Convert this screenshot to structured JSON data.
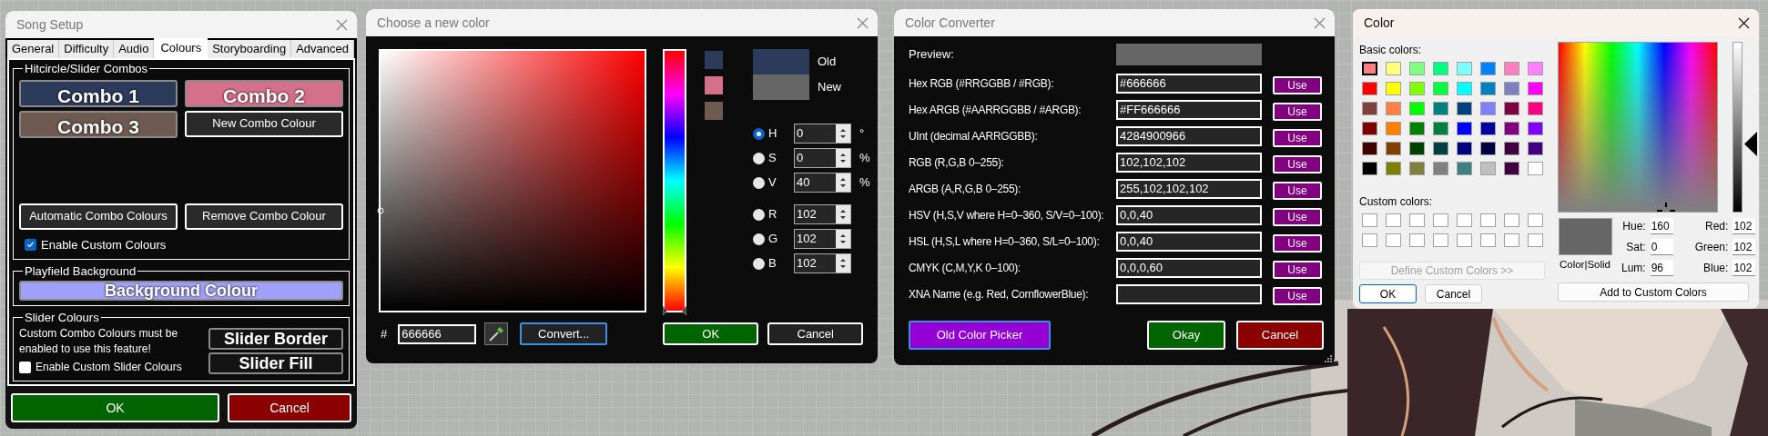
{
  "song_setup": {
    "title": "Song Setup",
    "tabs": [
      {
        "label": "General",
        "selected": false
      },
      {
        "label": "Difficulty",
        "selected": false
      },
      {
        "label": "Audio",
        "selected": false
      },
      {
        "label": "Colours",
        "selected": true
      },
      {
        "label": "Storyboarding",
        "selected": false
      },
      {
        "label": "Advanced",
        "selected": false
      }
    ],
    "combos": {
      "title": "Hitcircle/Slider Combos",
      "colours": [
        {
          "label": "Combo 1",
          "color": "#2c3a5c"
        },
        {
          "label": "Combo 2",
          "color": "#d4708a"
        },
        {
          "label": "Combo 3",
          "color": "#6e5a50"
        }
      ],
      "new_button": "New Combo Colour",
      "auto_button": "Automatic Combo Colours",
      "remove_button": "Remove Combo Colour",
      "enable": {
        "label": "Enable Custom Colours",
        "checked": true
      }
    },
    "playfield": {
      "title": "Playfield Background",
      "button": "Background Colour"
    },
    "slider": {
      "title": "Slider Colours",
      "note": "Custom Combo Colours must be enabled to use this feature!",
      "enable": {
        "label": "Enable Custom Slider Colours",
        "checked": false
      },
      "buttons": [
        "Slider Border",
        "Slider Fill"
      ]
    },
    "ok": "OK",
    "cancel": "Cancel"
  },
  "color_chooser": {
    "title": "Choose a new color",
    "recent": [
      {
        "color": "#2c3a5c"
      },
      {
        "color": "#d4708a"
      },
      {
        "color": "#6e5a50"
      }
    ],
    "hue_slider": {
      "level": 0
    },
    "old_label": "Old",
    "new_label": "New",
    "channels": [
      {
        "label": "H",
        "value": "0",
        "unit": "°",
        "selected": true
      },
      {
        "label": "S",
        "value": "0",
        "unit": "%",
        "selected": false
      },
      {
        "label": "V",
        "value": "40",
        "unit": "%",
        "selected": false
      },
      {
        "label": "R",
        "value": "102",
        "selected": false
      },
      {
        "label": "G",
        "value": "102",
        "selected": false
      },
      {
        "label": "B",
        "value": "102",
        "selected": false
      }
    ],
    "hash": "#",
    "hex": "666666",
    "convert": "Convert...",
    "ok": "OK",
    "cancel": "Cancel"
  },
  "color_converter": {
    "title": "Color Converter",
    "preview_label": "Preview:",
    "rows": [
      {
        "label": "Hex RGB (#RRGGBB / #RGB):",
        "value": "#666666",
        "button": "Use"
      },
      {
        "label": "Hex ARGB (#AARRGGBB / #ARGB):",
        "value": "#FF666666",
        "button": "Use"
      },
      {
        "label": "UInt (decimal AARRGGBB):",
        "value": "4284900966",
        "button": "Use"
      },
      {
        "label": "RGB (R,G,B 0–255):",
        "value": "102,102,102",
        "button": "Use"
      },
      {
        "label": "ARGB (A,R,G,B 0–255):",
        "value": "255,102,102,102",
        "button": "Use"
      },
      {
        "label": "HSV (H,S,V where H=0–360, S/V=0–100):",
        "value": "0,0,40",
        "button": "Use"
      },
      {
        "label": "HSL (H,S,L where H=0–360, S/L=0–100):",
        "value": "0,0,40",
        "button": "Use"
      },
      {
        "label": "CMYK (C,M,Y,K 0–100):",
        "value": "0,0,0,60",
        "button": "Use"
      },
      {
        "label": "XNA Name (e.g. Red, CornflowerBlue):",
        "button": "Use"
      }
    ],
    "old_picker": "Old Color Picker",
    "okay": "Okay",
    "cancel": "Cancel"
  },
  "color_dialog": {
    "title": "Color",
    "basic_label": "Basic colors:",
    "basic_colors": [
      {
        "color": "#ff8080",
        "selected": true
      },
      {
        "color": "#ffff80",
        "selected": false
      },
      {
        "color": "#80ff80",
        "selected": false
      },
      {
        "color": "#00ff80",
        "selected": false
      },
      {
        "color": "#80ffff",
        "selected": false
      },
      {
        "color": "#0080ff",
        "selected": false
      },
      {
        "color": "#ff80c0",
        "selected": false
      },
      {
        "color": "#ff80ff",
        "selected": false
      },
      {
        "color": "#ff0000",
        "selected": false
      },
      {
        "color": "#ffff00",
        "selected": false
      },
      {
        "color": "#80ff00",
        "selected": false
      },
      {
        "color": "#00ff40",
        "selected": false
      },
      {
        "color": "#00ffff",
        "selected": false
      },
      {
        "color": "#0080c0",
        "selected": false
      },
      {
        "color": "#8080c0",
        "selected": false
      },
      {
        "color": "#ff00ff",
        "selected": false
      },
      {
        "color": "#804040",
        "selected": false
      },
      {
        "color": "#ff8040",
        "selected": false
      },
      {
        "color": "#00ff00",
        "selected": false
      },
      {
        "color": "#008080",
        "selected": false
      },
      {
        "color": "#004080",
        "selected": false
      },
      {
        "color": "#8080ff",
        "selected": false
      },
      {
        "color": "#800040",
        "selected": false
      },
      {
        "color": "#ff0080",
        "selected": false
      },
      {
        "color": "#800000",
        "selected": false
      },
      {
        "color": "#ff8000",
        "selected": false
      },
      {
        "color": "#008000",
        "selected": false
      },
      {
        "color": "#008040",
        "selected": false
      },
      {
        "color": "#0000ff",
        "selected": false
      },
      {
        "color": "#0000a0",
        "selected": false
      },
      {
        "color": "#800080",
        "selected": false
      },
      {
        "color": "#8000ff",
        "selected": false
      },
      {
        "color": "#400000",
        "selected": false
      },
      {
        "color": "#804000",
        "selected": false
      },
      {
        "color": "#004000",
        "selected": false
      },
      {
        "color": "#004040",
        "selected": false
      },
      {
        "color": "#000080",
        "selected": false
      },
      {
        "color": "#000040",
        "selected": false
      },
      {
        "color": "#400040",
        "selected": false
      },
      {
        "color": "#400080",
        "selected": false
      },
      {
        "color": "#000000",
        "selected": false
      },
      {
        "color": "#808000",
        "selected": false
      },
      {
        "color": "#808040",
        "selected": false
      },
      {
        "color": "#808080",
        "selected": false
      },
      {
        "color": "#408080",
        "selected": false
      },
      {
        "color": "#c0c0c0",
        "selected": false
      },
      {
        "color": "#400040",
        "selected": false
      },
      {
        "color": "#ffffff",
        "selected": false
      }
    ],
    "custom_label": "Custom colors:",
    "define_button": {
      "label": "Define Custom Colors >>",
      "disabled": true
    },
    "ok": "OK",
    "cancel": "Cancel",
    "solid_label": "Color|Solid",
    "hsl_fields": [
      {
        "label": "Hue:",
        "value": "160"
      },
      {
        "label": "Sat:",
        "value": "0"
      },
      {
        "label": "Lum:",
        "value": "96"
      }
    ],
    "rgb_fields": [
      {
        "label": "Red:",
        "value": "102"
      },
      {
        "label": "Green:",
        "value": "102"
      },
      {
        "label": "Blue:",
        "value": "102"
      }
    ],
    "add_button": "Add to Custom Colors"
  }
}
